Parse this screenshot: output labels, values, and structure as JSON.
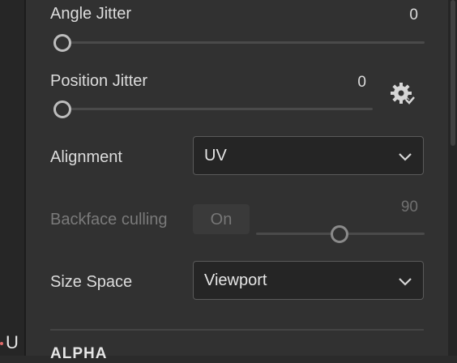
{
  "left_strip": {
    "letter": "U"
  },
  "properties": {
    "angle_jitter": {
      "label": "Angle Jitter",
      "value": "0",
      "slider_fraction": 0.0
    },
    "position_jitter": {
      "label": "Position Jitter",
      "value": "0",
      "slider_fraction": 0.0,
      "settings_icon": "gear-check-icon"
    },
    "alignment": {
      "label": "Alignment",
      "selected": "UV",
      "icon": "chevron-down-icon"
    },
    "backface_culling": {
      "label": "Backface culling",
      "toggle": "On",
      "value": "90",
      "slider_fraction": 0.5,
      "disabled": true
    },
    "size_space": {
      "label": "Size Space",
      "selected": "Viewport",
      "icon": "chevron-down-icon"
    }
  },
  "sections": {
    "alpha_title": "ALPHA"
  },
  "colors": {
    "panel_bg": "#313131",
    "dropdown_bg": "#252525",
    "text": "#dcdcdc",
    "disabled_text": "#7a7a7a",
    "track": "#4a4a4a",
    "knob": "#bdbdbd"
  }
}
